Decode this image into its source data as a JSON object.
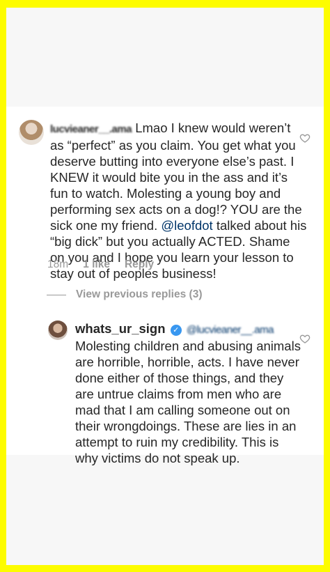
{
  "comment1": {
    "username": "lucvieaner__.ama",
    "text": "Lmao I knew would weren’t as “perfect” as you claim. You get what you deserve butting into everyone else’s past. I KNEW it would bite you in the ass and it’s fun to watch. Molesting a young boy and performing sex acts on a dog!? YOU are the sick one my friend. ",
    "mention": "@leofdot",
    "text_after": " talked about his “big dick” but you actually ACTED. Shame on you and I hope you learn your lesson to stay out of peoples business!",
    "time": "18m",
    "likes": "1 like",
    "reply_label": "Reply"
  },
  "view_previous_replies": "View previous replies (3)",
  "comment2": {
    "username": "whats_ur_sign",
    "verified_glyph": "✓",
    "mention": "@lucvieaner__.ama",
    "text": "Molesting children and abusing animals are horrible, horrible, acts. I have never done either of those things, and they are untrue claims from men who are mad that I am calling someone out on their wrongdoings. These are lies in an attempt to ruin my credibility. This is why victims do not speak up."
  },
  "colors": {
    "background": "#fdfc00",
    "card": "#ffffff",
    "muted": "#999999",
    "verified": "#3897f0"
  },
  "icons": [
    "heart-icon",
    "verified-badge-icon",
    "avatar"
  ]
}
